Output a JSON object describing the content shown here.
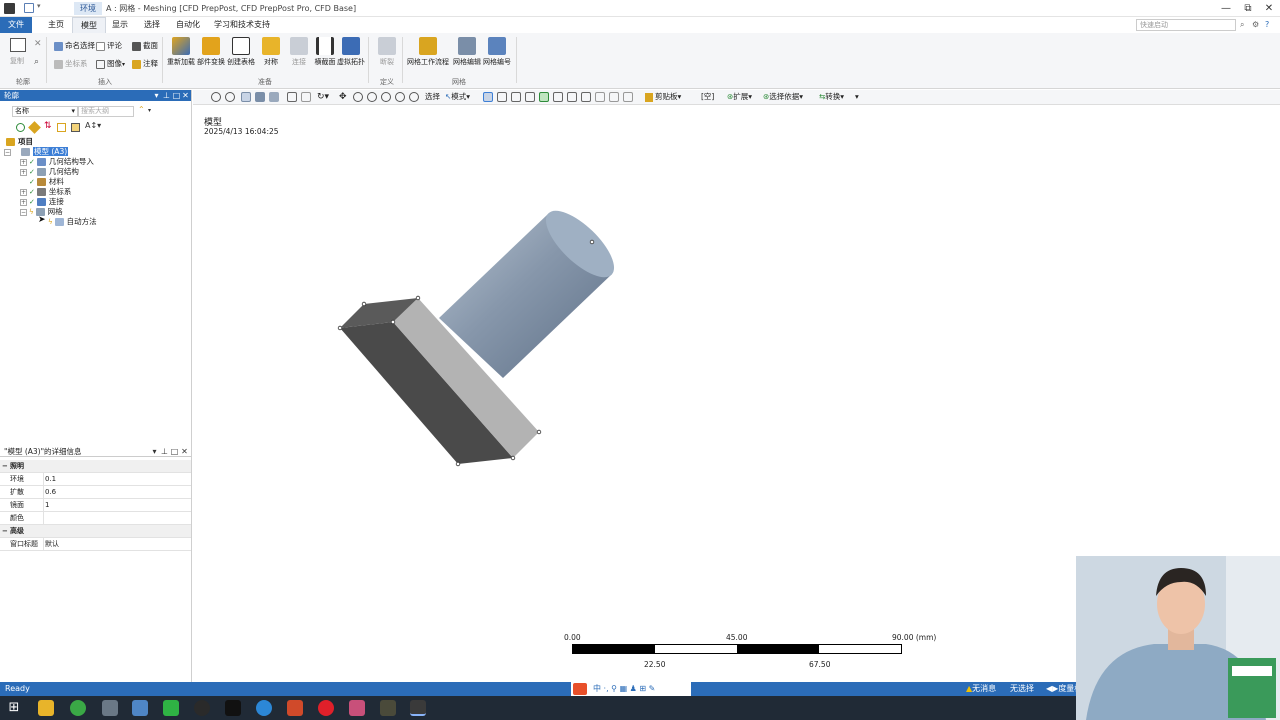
{
  "titlebar": {
    "context_tab": "环境",
    "title": "A : 网格 - Meshing [CFD PrepPost, CFD PrepPost Pro, CFD Base]",
    "buttons": [
      "—",
      "⧉",
      "✕"
    ]
  },
  "tabs": [
    {
      "label": "文件"
    },
    {
      "label": "主页"
    },
    {
      "label": "模型"
    },
    {
      "label": "显示"
    },
    {
      "label": "选择"
    },
    {
      "label": "自动化"
    },
    {
      "label": "学习和技术支持"
    }
  ],
  "quick_search_placeholder": "快速启动",
  "ribbon": {
    "groups": {
      "outline": "轮廓",
      "insert": "插入",
      "prepare": "准备",
      "define": "定义",
      "mesh": "网格"
    },
    "outline": {
      "duplicate": "复制"
    },
    "insert_small": [
      {
        "label": "命名选择"
      },
      {
        "label": "评论"
      },
      {
        "label": "截面"
      },
      {
        "label": "坐标系"
      },
      {
        "label": "图像"
      },
      {
        "label": "注释"
      }
    ],
    "prepare_big": [
      {
        "label": "重新加载"
      },
      {
        "label": "部件变换"
      },
      {
        "label": "创建表格"
      },
      {
        "label": "对称"
      },
      {
        "label": "连接"
      },
      {
        "label": "横截面"
      },
      {
        "label": "虚拟拓扑"
      }
    ],
    "define_big": [
      {
        "label": "断裂"
      }
    ],
    "mesh_big": [
      {
        "label": "网格工作流程"
      },
      {
        "label": "网格编辑"
      },
      {
        "label": "网格编号"
      }
    ]
  },
  "outline_panel": {
    "title": "轮廓",
    "filter_label": "名称",
    "search_placeholder": "搜索大纲",
    "tree": [
      {
        "label": "项目"
      },
      {
        "label": "模型 (A3)"
      },
      {
        "label": "几何结构导入"
      },
      {
        "label": "几何结构"
      },
      {
        "label": "材料"
      },
      {
        "label": "坐标系"
      },
      {
        "label": "连接"
      },
      {
        "label": "网格"
      },
      {
        "label": "自动方法"
      }
    ]
  },
  "details_panel": {
    "title": "\"模型 (A3)\"的详细信息",
    "sections": [
      {
        "label": "照明"
      },
      {
        "label": "高级"
      }
    ],
    "rows": [
      {
        "key": "环境",
        "value": "0.1"
      },
      {
        "key": "扩散",
        "value": "0.6"
      },
      {
        "key": "镜面",
        "value": "1"
      },
      {
        "key": "颜色",
        "value": ""
      },
      {
        "key": "窗口标题",
        "value": "默认"
      }
    ]
  },
  "graphics_toolbar": {
    "select": "选择",
    "mode": "模式",
    "clipboard": "剪贴板",
    "empty": "[空]",
    "extend": "扩展",
    "select_by": "选择依据",
    "convert": "转换"
  },
  "viewport": {
    "model_label": "模型",
    "timestamp": "2025/4/13 16:04:25",
    "scale": {
      "top_labels": [
        "0.00",
        "45.00",
        "90.00 (mm)"
      ],
      "bottom_labels": [
        "22.50",
        "67.50"
      ]
    }
  },
  "status": {
    "text": "Ready",
    "messages": "无消息",
    "selection": "无选择",
    "units": "度量标"
  },
  "colors": {
    "accent": "#2b6cb8",
    "body_dark": "#4a4a4a",
    "body_light": "#b3b3b3",
    "cylinder": "#8da0b4"
  }
}
